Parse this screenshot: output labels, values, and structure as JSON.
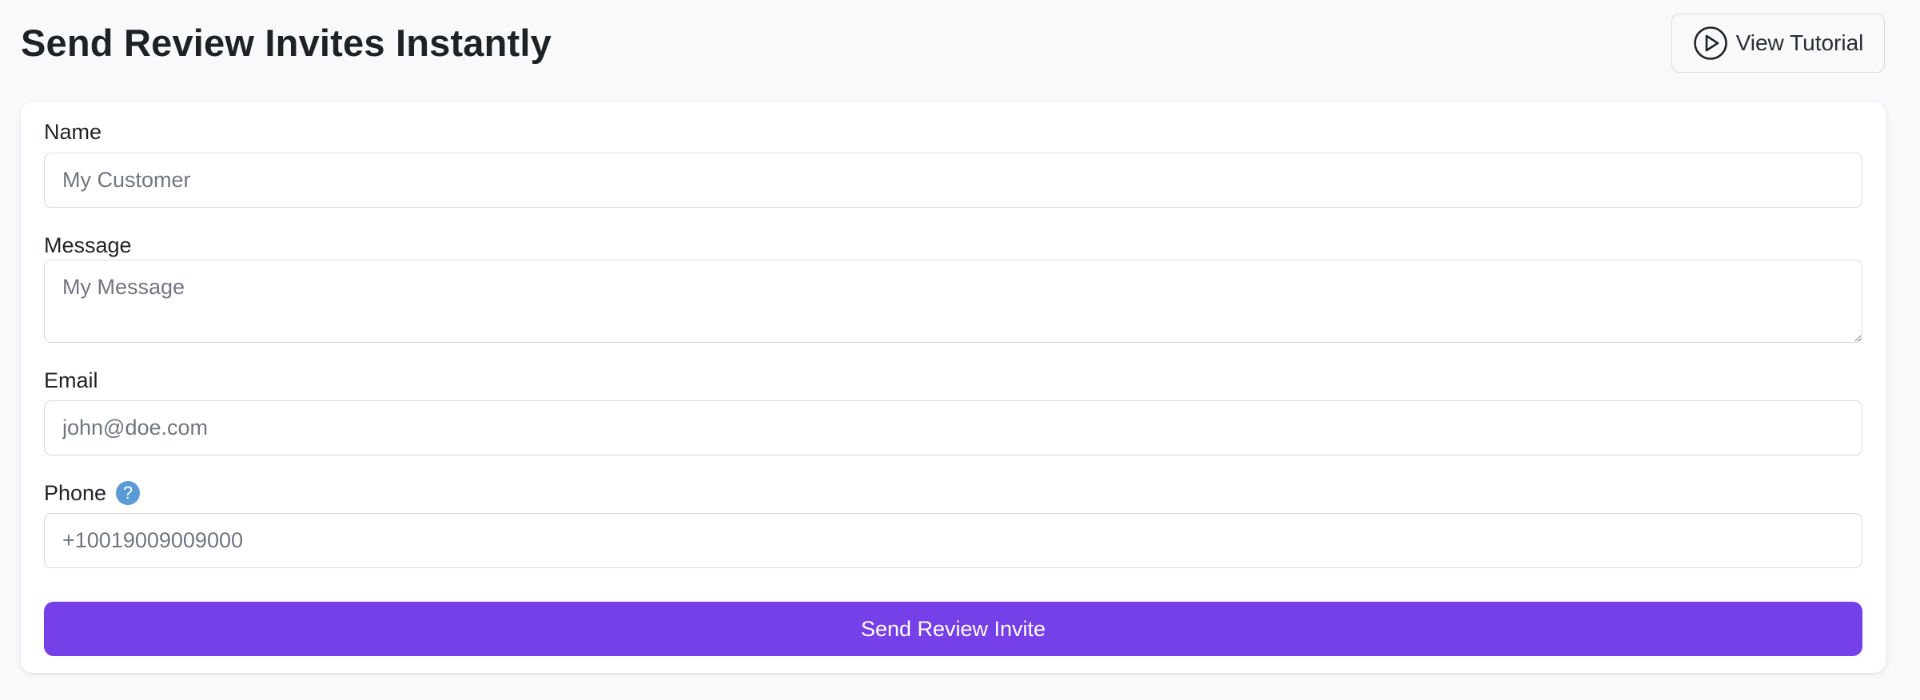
{
  "header": {
    "title": "Send Review Invites Instantly",
    "tutorial_label": "View Tutorial",
    "tutorial_icon": "play-circle-icon"
  },
  "form": {
    "name": {
      "label": "Name",
      "placeholder": "My Customer",
      "value": ""
    },
    "message": {
      "label": "Message",
      "placeholder": "My Message",
      "value": ""
    },
    "email": {
      "label": "Email",
      "placeholder": "john@doe.com",
      "value": ""
    },
    "phone": {
      "label": "Phone",
      "placeholder": "+10019009009000",
      "value": "",
      "help_glyph": "?",
      "help_icon": "help-circle-icon"
    },
    "submit_label": "Send Review Invite"
  },
  "colors": {
    "background": "#f8f9fb",
    "accent": "#7540e8",
    "help_icon": "#5b9bd5",
    "border": "#d6d9de"
  }
}
